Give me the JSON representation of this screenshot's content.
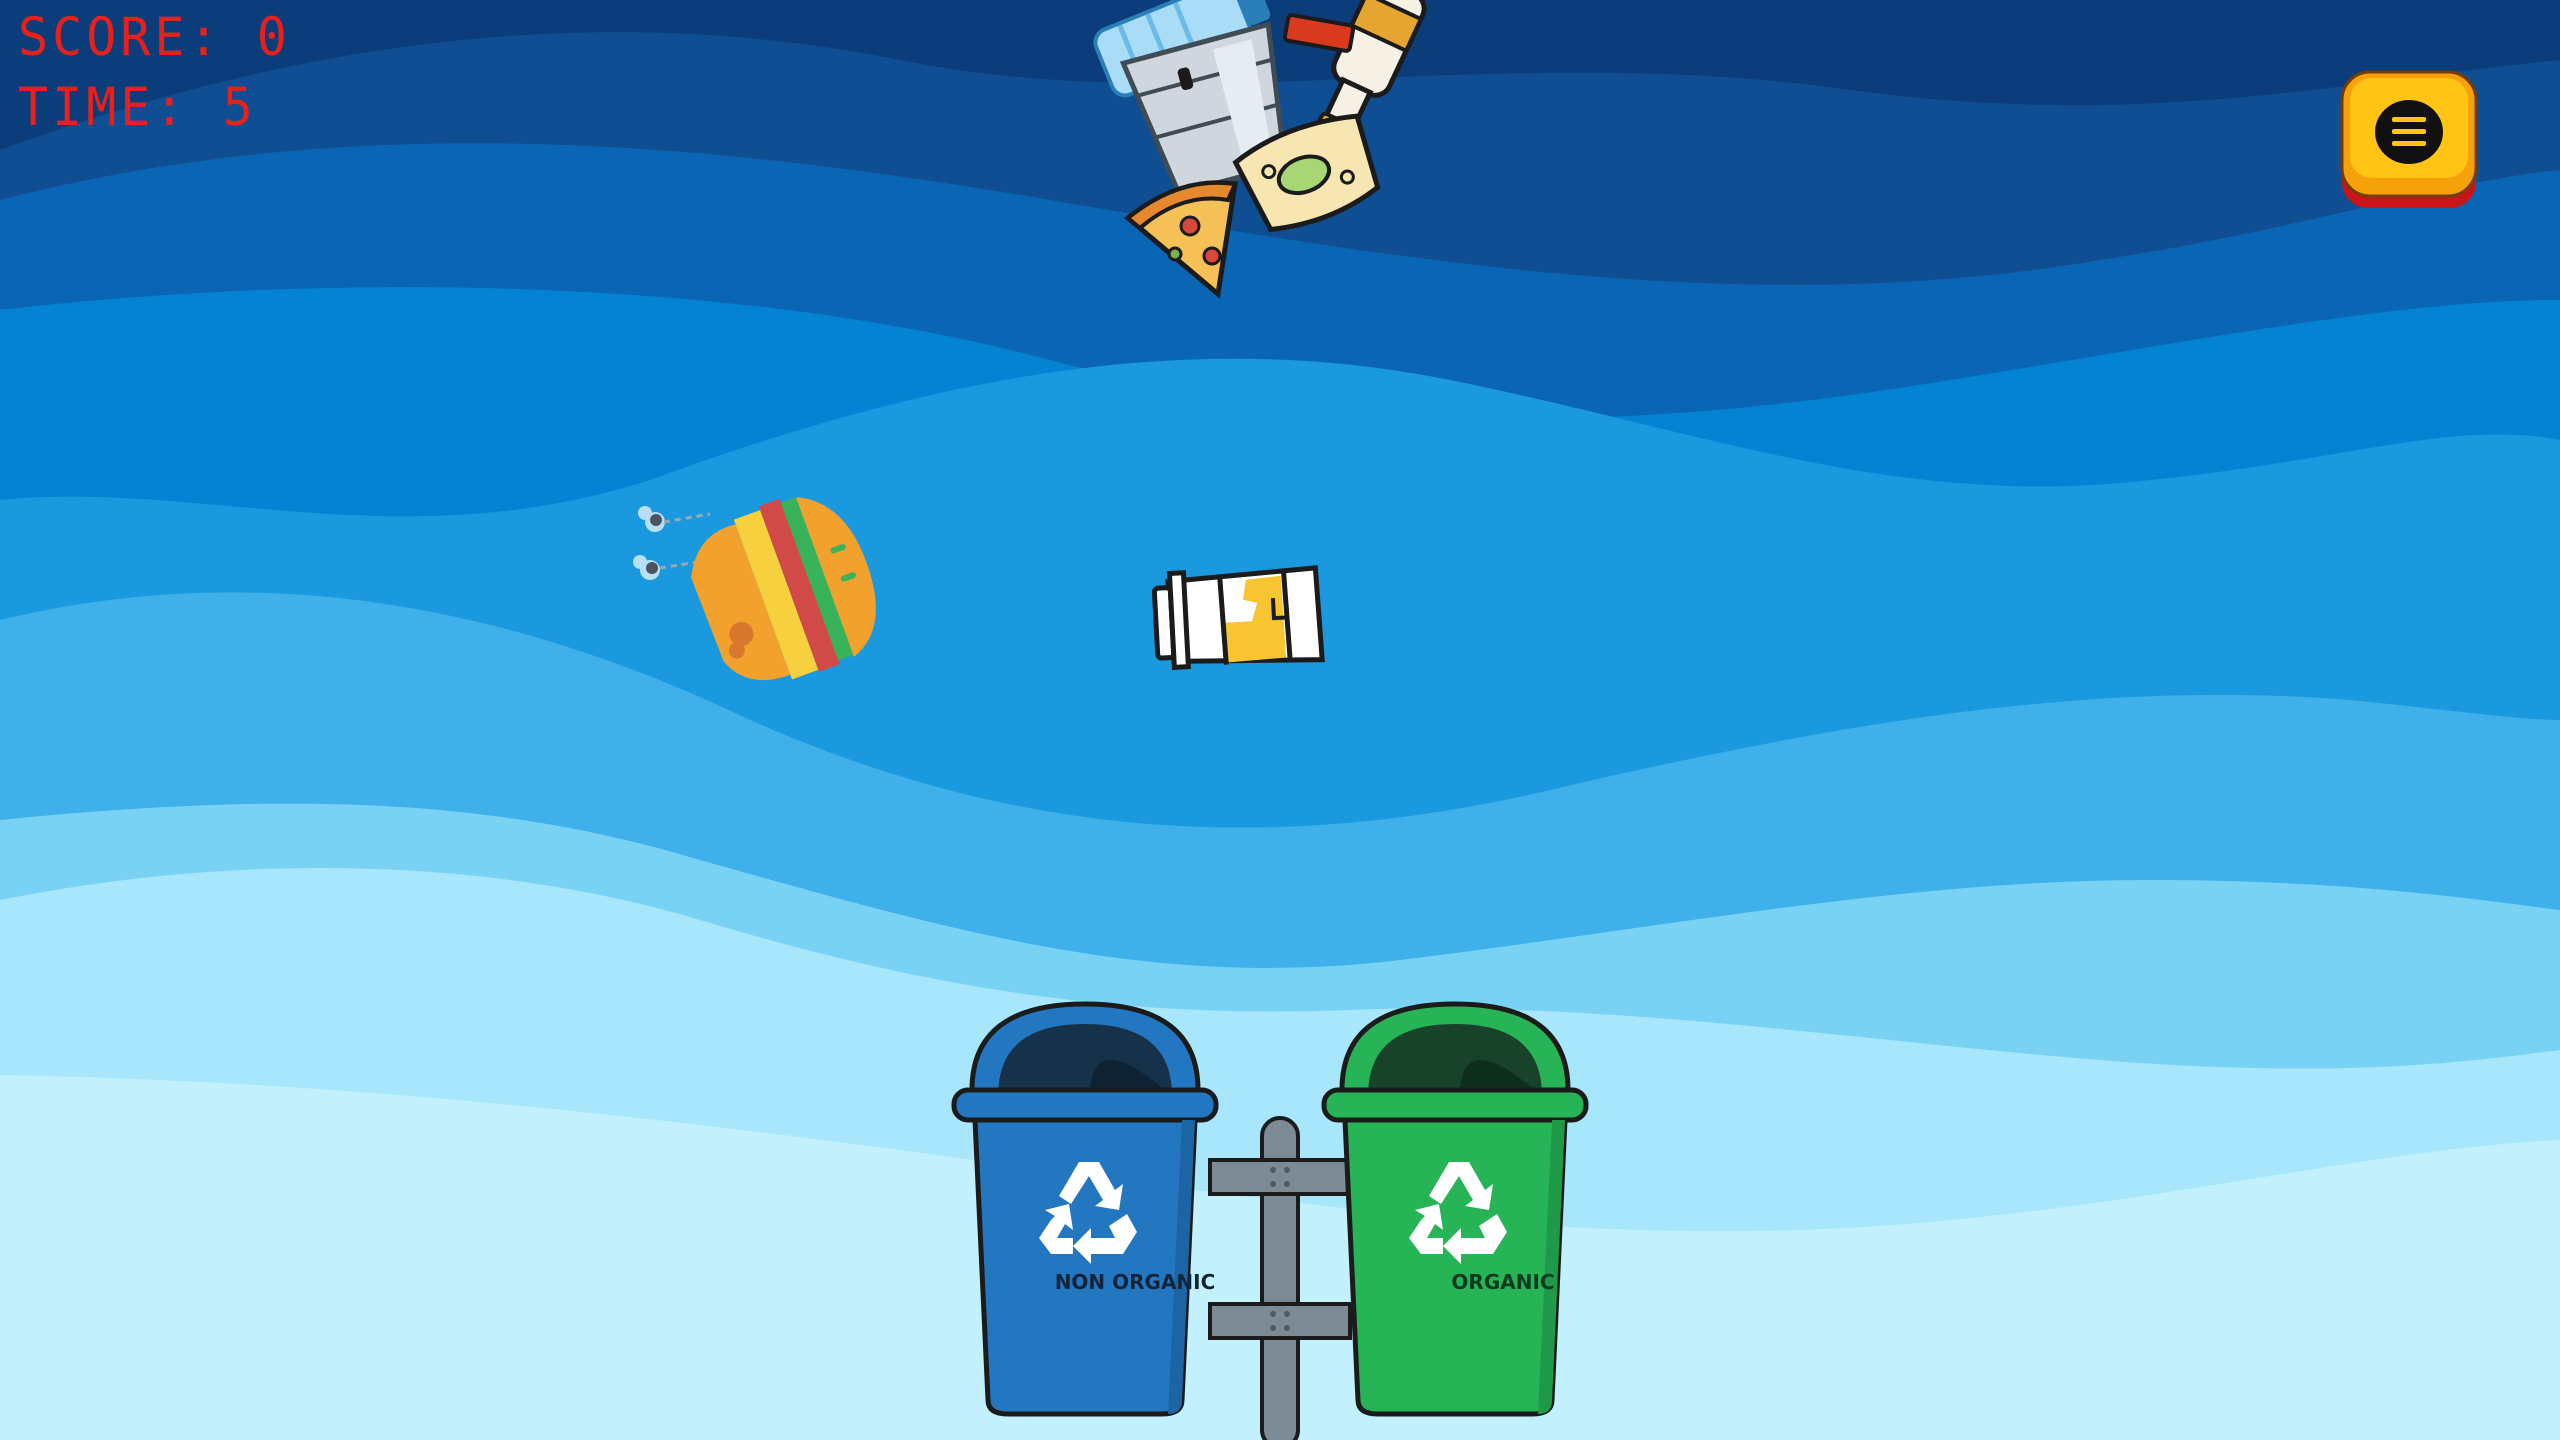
{
  "hud": {
    "score_label": "SCORE: 0",
    "time_label": "TIME: 5"
  },
  "menu": {
    "icon": "hamburger-menu-icon",
    "color": "#f7b500"
  },
  "bins": {
    "non_organic": {
      "label": "NON ORGANIC",
      "color": "#2277c0",
      "icon": "recycle-icon"
    },
    "organic": {
      "label": "ORGANIC",
      "color": "#27b457",
      "icon": "recycle-icon"
    }
  },
  "falling_items": [
    {
      "kind": "plastic-bottle-icon"
    },
    {
      "kind": "glass-bottle-icon"
    },
    {
      "kind": "plastic-cup-icon"
    },
    {
      "kind": "food-scrap-icon"
    },
    {
      "kind": "pizza-slice-icon"
    },
    {
      "kind": "rotten-burger-icon"
    },
    {
      "kind": "paper-cup-icon"
    }
  ],
  "colors": {
    "sky_top": "#0a3d7a",
    "sky_bottom": "#c9f3fd",
    "hud_text": "#e8201c"
  }
}
